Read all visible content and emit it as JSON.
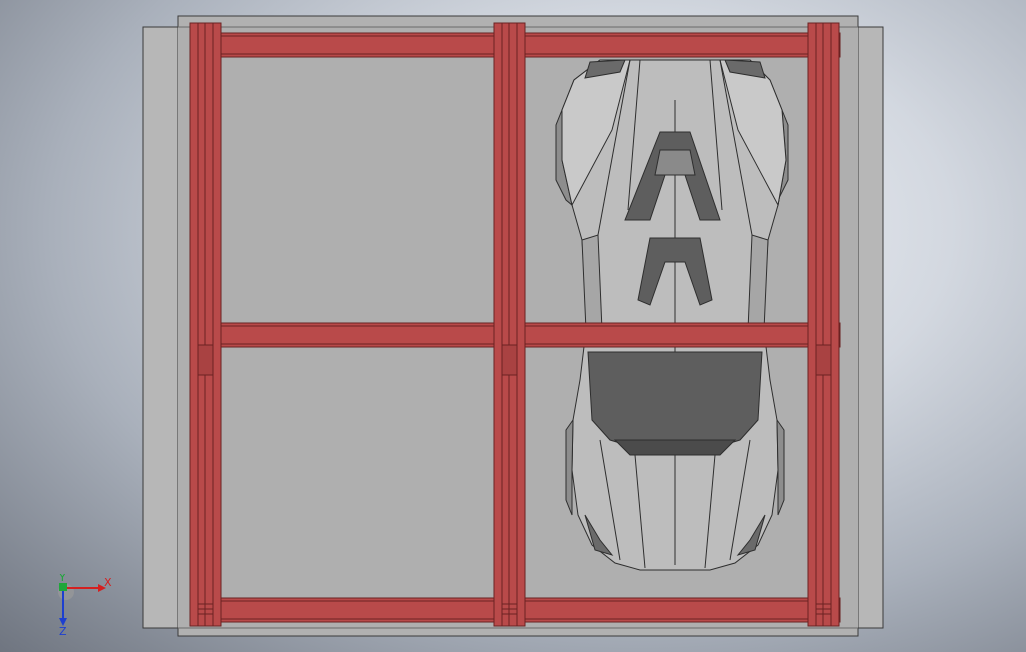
{
  "app": {
    "view": "top"
  },
  "scene": {
    "background_colors": [
      "#eef1f6",
      "#a9b0bb",
      "#6f7580"
    ],
    "base_plate_color": "#b3b3b3",
    "frame_color": "#b94a4a",
    "frame_edge_color": "#6a2222",
    "car_body_color": "#bdbdbd",
    "car_dark_color": "#5e5e5e",
    "car_line_color": "#2e2e2e"
  },
  "triad": {
    "x_label": "X",
    "y_label": "Y",
    "z_label": "Z",
    "x_color": "#d42020",
    "y_color": "#1fa63a",
    "z_color": "#1d3fd0"
  }
}
